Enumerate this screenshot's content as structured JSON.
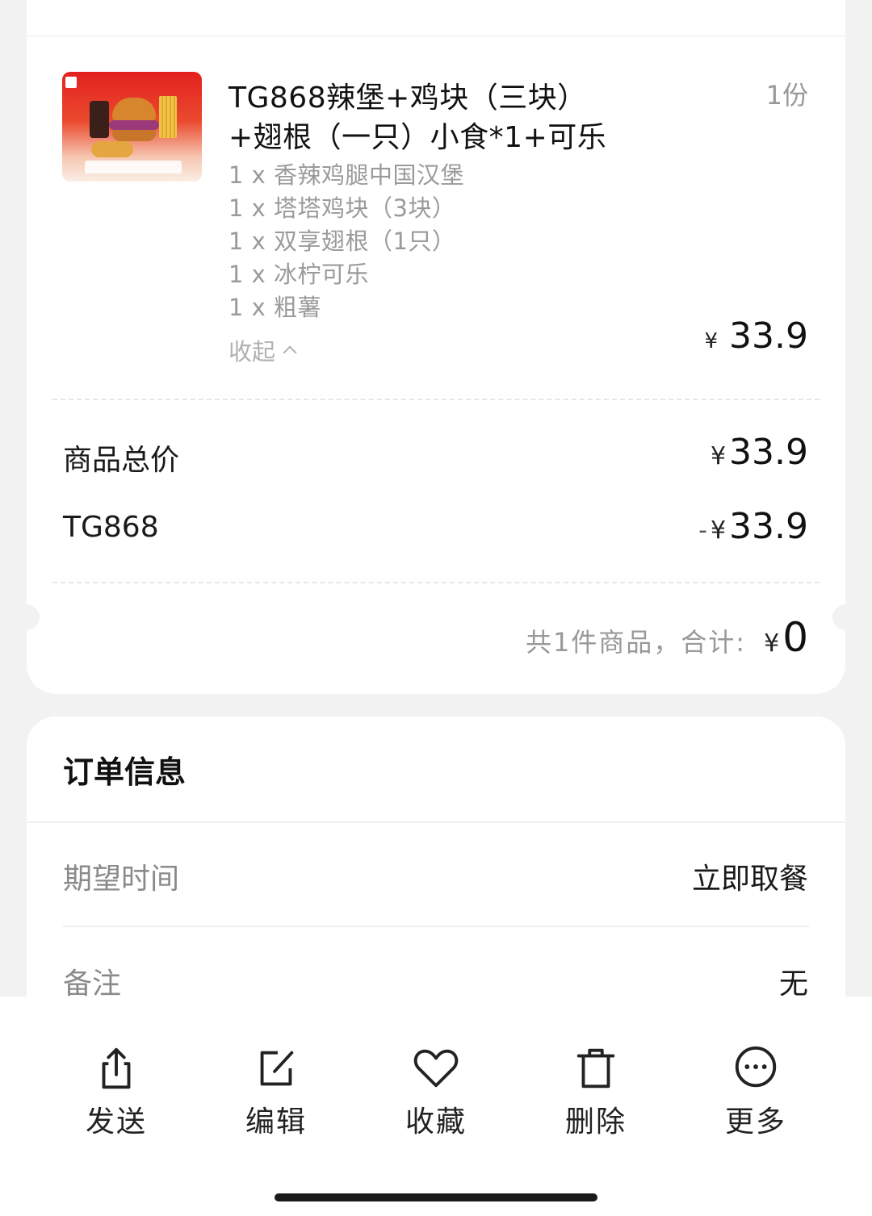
{
  "order_item": {
    "title_line1": "TG868辣堡+鸡块（三块）",
    "title_line2": "+翅根（一只）小食*1+可乐",
    "quantity": "1份",
    "sub_items": [
      "1 x 香辣鸡腿中国汉堡",
      "1 x 塔塔鸡块（3块）",
      "1 x 双享翅根（1只）",
      "1 x 冰柠可乐",
      "1 x 粗薯"
    ],
    "collapse_label": "收起",
    "currency": "¥",
    "price": "33.9"
  },
  "price_summary": {
    "goods_total_label": "商品总价",
    "goods_total_value": "33.9",
    "coupon_label": "TG868",
    "coupon_minus": "-",
    "coupon_value": "33.9",
    "count_text": "共1件商品，合计:",
    "total_value": "0"
  },
  "order_info": {
    "title": "订单信息",
    "rows": [
      {
        "label": "期望时间",
        "value": "立即取餐"
      },
      {
        "label": "备注",
        "value": "无"
      }
    ]
  },
  "toolbar": {
    "items": [
      {
        "label": "发送",
        "icon": "share-icon"
      },
      {
        "label": "编辑",
        "icon": "edit-icon"
      },
      {
        "label": "收藏",
        "icon": "heart-icon"
      },
      {
        "label": "删除",
        "icon": "trash-icon"
      },
      {
        "label": "更多",
        "icon": "more-icon"
      }
    ]
  }
}
